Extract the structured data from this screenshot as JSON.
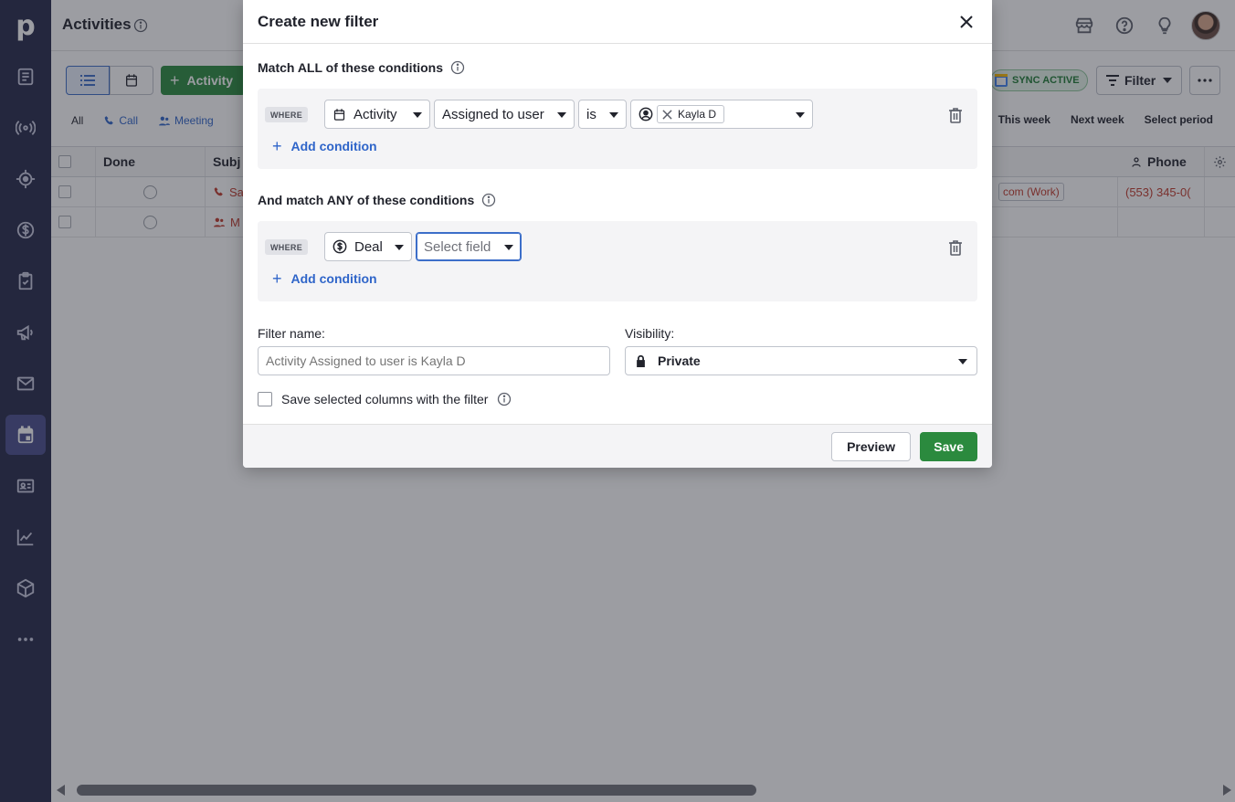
{
  "app": {
    "logo": "p",
    "page_title": "Activities"
  },
  "sidebar": {
    "items": [
      {
        "name": "leads",
        "icon": "leads-inbox-icon"
      },
      {
        "name": "deals",
        "icon": "broadcast-icon"
      },
      {
        "name": "target",
        "icon": "target-icon"
      },
      {
        "name": "money",
        "icon": "dollar-icon"
      },
      {
        "name": "tasks",
        "icon": "clipboard-icon"
      },
      {
        "name": "campaigns",
        "icon": "megaphone-icon"
      },
      {
        "name": "mail",
        "icon": "mail-icon"
      },
      {
        "name": "activities",
        "icon": "calendar-icon",
        "active": true
      },
      {
        "name": "contacts",
        "icon": "contact-card-icon"
      },
      {
        "name": "insights",
        "icon": "chart-icon"
      },
      {
        "name": "products",
        "icon": "box-icon"
      },
      {
        "name": "more",
        "icon": "ellipsis-icon"
      }
    ]
  },
  "toolbar": {
    "add_activity_label": "Activity",
    "sync_label": "SYNC ACTIVE",
    "filter_label": "Filter",
    "type_tabs": [
      "All",
      "Call",
      "Meeting"
    ],
    "period_tabs": [
      "This week",
      "Next week",
      "Select period"
    ]
  },
  "table": {
    "columns": {
      "done": "Done",
      "subject": "Subj",
      "phone": "Phone"
    },
    "rows": [
      {
        "subject_fragment": "Sa",
        "email_fragment": "com (Work)",
        "phone": "(553) 345-0("
      },
      {
        "subject_fragment": "M",
        "email_fragment": "",
        "phone": ""
      }
    ]
  },
  "modal": {
    "title": "Create new filter",
    "match_all_label": "Match ALL of these conditions",
    "match_any_label": "And match ANY of these conditions",
    "where_label": "WHERE",
    "add_condition_label": "Add condition",
    "all_condition": {
      "entity": "Activity",
      "field": "Assigned to user",
      "operator": "is",
      "value_tag": "Kayla D"
    },
    "any_condition": {
      "entity": "Deal",
      "field_placeholder": "Select field"
    },
    "filter_name_label": "Filter name:",
    "filter_name_placeholder": "Activity Assigned to user is Kayla D",
    "visibility_label": "Visibility:",
    "visibility_value": "Private",
    "save_columns_label": "Save selected columns with the filter",
    "preview_label": "Preview",
    "save_label": "Save"
  },
  "colors": {
    "sidebar_bg": "#26294a",
    "primary_green": "#2b8a3e",
    "link_blue": "#2f65c9",
    "overlay": "rgba(36,38,48,0.45)"
  }
}
